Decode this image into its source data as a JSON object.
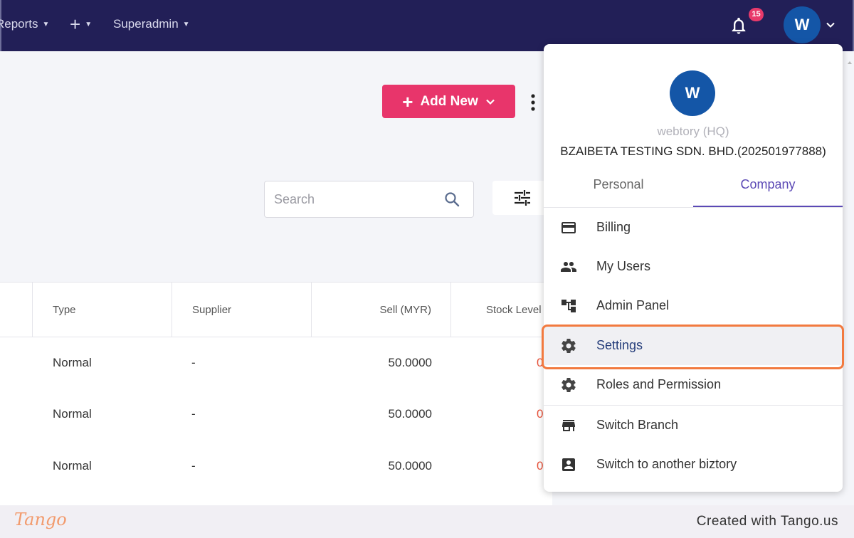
{
  "topbar": {
    "nav": [
      {
        "label": "Reports"
      },
      {
        "label": ""
      },
      {
        "label": "Superadmin"
      }
    ],
    "notification_count": "15",
    "avatar_initial": "W"
  },
  "toolbar": {
    "add_new_label": "Add New"
  },
  "search": {
    "placeholder": "Search",
    "value": ""
  },
  "table": {
    "columns": [
      "Type",
      "Supplier",
      "Sell (MYR)",
      "Stock Level"
    ],
    "rows": [
      {
        "type": "Normal",
        "supplier": "-",
        "sell": "50.0000",
        "stock": "0"
      },
      {
        "type": "Normal",
        "supplier": "-",
        "sell": "50.0000",
        "stock": "0"
      },
      {
        "type": "Normal",
        "supplier": "-",
        "sell": "50.0000",
        "stock": "0"
      }
    ]
  },
  "dropdown": {
    "avatar_initial": "W",
    "user_name": "webtory (HQ)",
    "company": "BZAIBETA TESTING SDN. BHD.(202501977888)",
    "tabs": [
      {
        "label": "Personal",
        "active": false
      },
      {
        "label": "Company",
        "active": true
      }
    ],
    "items": [
      {
        "label": "Billing",
        "icon": "credit-card-icon"
      },
      {
        "label": "My Users",
        "icon": "users-icon"
      },
      {
        "label": "Admin Panel",
        "icon": "hierarchy-icon"
      },
      {
        "label": "Settings",
        "icon": "gear-icon",
        "highlighted": true
      },
      {
        "label": "Roles and Permission",
        "icon": "gear-icon"
      },
      {
        "label": "Switch Branch",
        "icon": "store-icon"
      },
      {
        "label": "Switch to another biztory",
        "icon": "account-box-icon"
      }
    ]
  },
  "footer": {
    "logo": "Tango",
    "credit": "Created with Tango.us"
  },
  "colors": {
    "topbar": "#221f57",
    "accent": "#e8356b",
    "avatar": "#1456a7",
    "tab_active": "#5b49b5",
    "highlight": "#f27a3f"
  }
}
